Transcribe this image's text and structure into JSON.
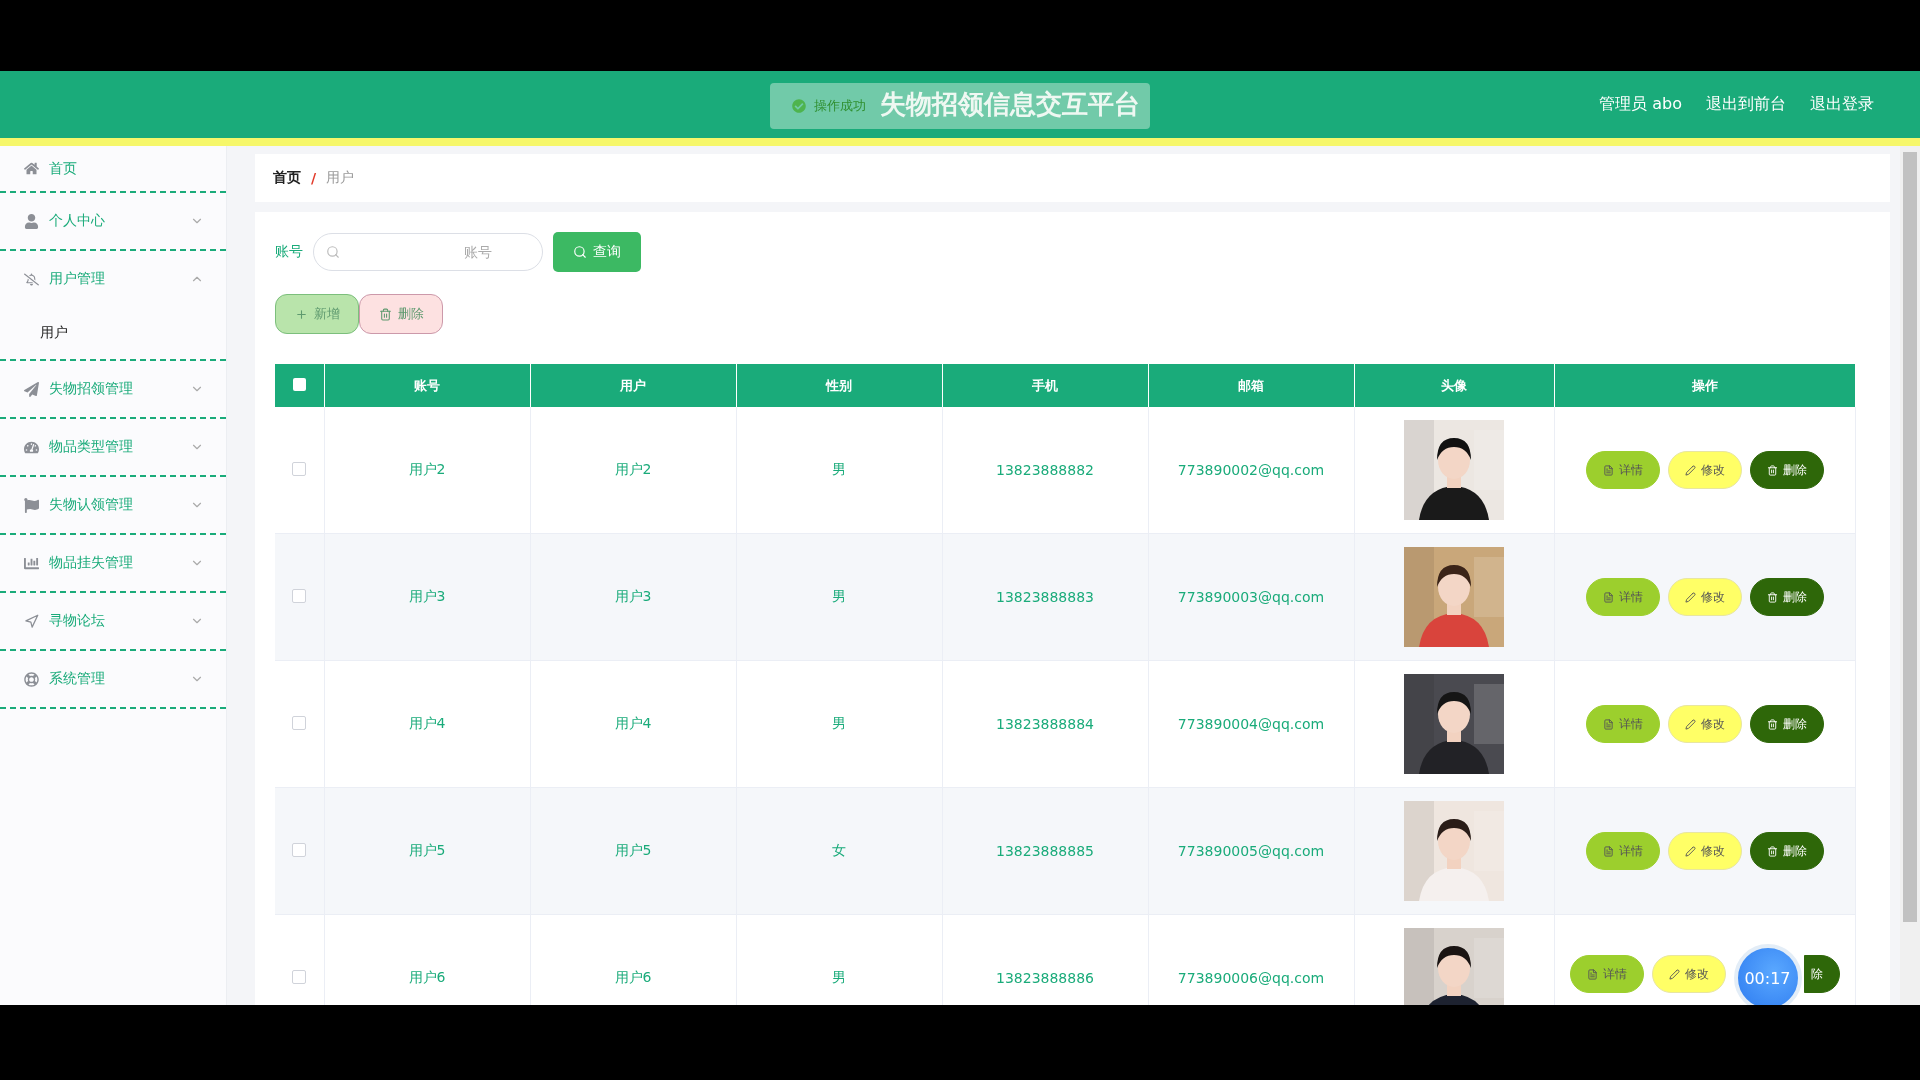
{
  "header": {
    "title": "失物招领信息交互平台",
    "user": "管理员 abo",
    "links": [
      "退出到前台",
      "退出登录"
    ]
  },
  "toast": {
    "text": "操作成功"
  },
  "sidebar": {
    "items": [
      {
        "label": "首页",
        "kind": "link"
      },
      {
        "label": "个人中心",
        "kind": "menu",
        "expanded": false
      },
      {
        "label": "用户管理",
        "kind": "menu",
        "expanded": true,
        "children": [
          {
            "label": "用户"
          }
        ]
      },
      {
        "label": "失物招领管理",
        "kind": "menu",
        "expanded": false
      },
      {
        "label": "物品类型管理",
        "kind": "menu",
        "expanded": false
      },
      {
        "label": "失物认领管理",
        "kind": "menu",
        "expanded": false
      },
      {
        "label": "物品挂失管理",
        "kind": "menu",
        "expanded": false
      },
      {
        "label": "寻物论坛",
        "kind": "menu",
        "expanded": false
      },
      {
        "label": "系统管理",
        "kind": "menu",
        "expanded": false
      }
    ]
  },
  "breadcrumb": {
    "items": [
      "首页",
      "用户"
    ],
    "separator": "/"
  },
  "search": {
    "label": "账号",
    "placeholder": "账号",
    "button": "查询"
  },
  "actions": [
    "新增",
    "删除"
  ],
  "table": {
    "columns": [
      "账号",
      "用户",
      "性别",
      "手机",
      "邮箱",
      "头像",
      "操作"
    ],
    "rows": [
      {
        "checked": false,
        "cells": [
          "用户2",
          "用户2",
          "男",
          "13823888882",
          "773890002@qq.com"
        ],
        "buttons": [
          "详情",
          "修改",
          "删除"
        ]
      },
      {
        "checked": false,
        "cells": [
          "用户3",
          "用户3",
          "男",
          "13823888883",
          "773890003@qq.com"
        ],
        "buttons": [
          "详情",
          "修改",
          "删除"
        ]
      },
      {
        "checked": false,
        "cells": [
          "用户4",
          "用户4",
          "男",
          "13823888884",
          "773890004@qq.com"
        ],
        "buttons": [
          "详情",
          "修改",
          "删除"
        ]
      },
      {
        "checked": false,
        "cells": [
          "用户5",
          "用户5",
          "女",
          "13823888885",
          "773890005@qq.com"
        ],
        "buttons": [
          "详情",
          "修改",
          "删除"
        ]
      },
      {
        "checked": false,
        "cells": [
          "用户6",
          "用户6",
          "男",
          "13823888886",
          "773890006@qq.com"
        ],
        "buttons": [
          "详情",
          "修改",
          "除"
        ]
      }
    ]
  },
  "timer": "00:17"
}
